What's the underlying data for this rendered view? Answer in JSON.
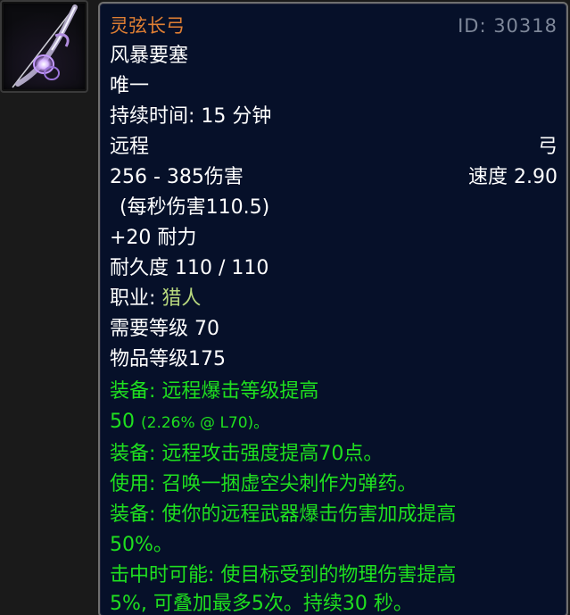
{
  "item": {
    "name": "灵弦长弓",
    "id_label": "ID: 30318",
    "instance": "风暴要塞",
    "unique": "唯一",
    "duration": "持续时间: 15 分钟",
    "slot": "远程",
    "weapon_type": "弓",
    "damage": "256 - 385伤害",
    "speed": "速度 2.90",
    "dps": "(每秒伤害110.5)",
    "stamina": "+20 耐力",
    "durability": "耐久度 110 / 110",
    "class_prefix": "职业:",
    "class_name": "猎人",
    "required_level": "需要等级 70",
    "item_level": "物品等级175",
    "effects": {
      "equip_crit_1": "装备:  远程爆击等级提高",
      "equip_crit_2_value": "50",
      "equip_crit_2_detail": "(2.26% @ L70)。",
      "equip_ap": "装备:  远程攻击强度提高70点。",
      "use_ammo": "使用:  召唤一捆虚空尖刺作为弹药。",
      "equip_critdmg_1": "装备:  使你的远程武器爆击伤害加成提高",
      "equip_critdmg_2": "50%。",
      "proc_1": "击中时可能:  使目标受到的物理伤害提高",
      "proc_2": "5%, 可叠加最多5次。持续30 秒。"
    }
  },
  "colors": {
    "background": "#061029",
    "name_orange": "#e07f33",
    "id_gray": "#7e8799",
    "white": "#ffffff",
    "class_green": "#b8d87e",
    "effect_green": "#1fe01f"
  },
  "icon": "bow-icon"
}
